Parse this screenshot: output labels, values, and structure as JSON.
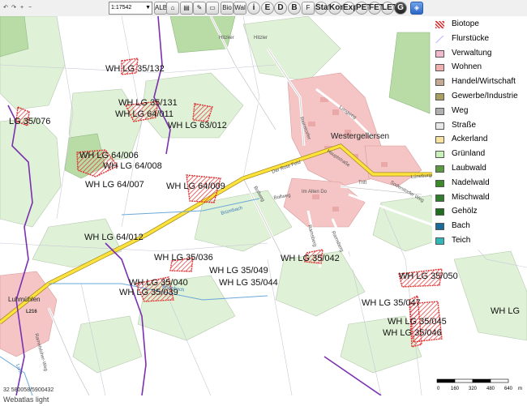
{
  "app": {
    "title": "Webatlas light",
    "coordinates": "32 580058/5900432"
  },
  "toolbar": {
    "scale": "1:17542",
    "buttons": [
      {
        "name": "undo-button",
        "label": "↶",
        "icon": "undo-icon"
      },
      {
        "name": "redo-button",
        "label": "↷",
        "icon": "redo-icon"
      },
      {
        "name": "zoom-in-button",
        "label": "+",
        "icon": "zoom-in-icon"
      },
      {
        "name": "zoom-out-button",
        "label": "−",
        "icon": "zoom-out-icon"
      },
      {
        "name": "alb-button",
        "label": "ALB",
        "icon": "alb-icon"
      },
      {
        "name": "home-button",
        "label": "⌂",
        "icon": "home-icon"
      },
      {
        "name": "print-button",
        "label": "▤",
        "icon": "print-icon"
      },
      {
        "name": "eraser-button",
        "label": "✎",
        "icon": "eraser-icon"
      },
      {
        "name": "measure-area-button",
        "label": "▭",
        "icon": "measure-icon"
      },
      {
        "name": "bio-button",
        "label": "Bio",
        "icon": "bio-icon"
      },
      {
        "name": "wald-button",
        "label": "Wal",
        "icon": "wald-icon"
      },
      {
        "name": "info-button",
        "label": "i",
        "icon": "info-icon"
      },
      {
        "name": "e-button",
        "label": "E",
        "icon": "e-icon"
      },
      {
        "name": "d-button",
        "label": "D",
        "icon": "d-icon"
      },
      {
        "name": "b-button",
        "label": "B",
        "icon": "b-icon"
      },
      {
        "name": "f-button",
        "label": "F",
        "icon": "f-icon"
      },
      {
        "name": "stat-button",
        "label": "Stat",
        "icon": "stat-icon"
      },
      {
        "name": "kons-button",
        "label": "Kons",
        "icon": "kons-icon"
      },
      {
        "name": "exp-button",
        "label": "Exp",
        "icon": "export-icon"
      },
      {
        "name": "pet-button",
        "label": "PET",
        "icon": "pet-icon"
      },
      {
        "name": "fet-button",
        "label": "FET",
        "icon": "fet-icon"
      },
      {
        "name": "let-button",
        "label": "LET",
        "icon": "let-icon"
      },
      {
        "name": "g-button",
        "label": "G",
        "icon": "g-icon"
      },
      {
        "name": "map-view-button",
        "label": "◈",
        "icon": "map-view-icon"
      }
    ]
  },
  "legend": [
    {
      "label": "Biotope",
      "color": "#e03030",
      "style": "hatch"
    },
    {
      "label": "Flurstücke",
      "color": "#c8c8ff",
      "style": "line"
    },
    {
      "label": "Verwaltung",
      "color": "#f2b8cc"
    },
    {
      "label": "Wohnen",
      "color": "#f0b0b0"
    },
    {
      "label": "Handel/Wirtschaft",
      "color": "#c4a890"
    },
    {
      "label": "Gewerbe/Industrie",
      "color": "#a8a060"
    },
    {
      "label": "Weg",
      "color": "#b0b0b0"
    },
    {
      "label": "Straße",
      "color": "#e8e8e8"
    },
    {
      "label": "Ackerland",
      "color": "#f8e3a0"
    },
    {
      "label": "Grünland",
      "color": "#c8f0b8"
    },
    {
      "label": "Laubwald",
      "color": "#5a9a40"
    },
    {
      "label": "Nadelwald",
      "color": "#3a8a2a"
    },
    {
      "label": "Mischwald",
      "color": "#2e7e2e"
    },
    {
      "label": "Gehölz",
      "color": "#1e6e1e"
    },
    {
      "label": "Bach",
      "color": "#1a6a9a"
    },
    {
      "label": "Teich",
      "color": "#30b8b8"
    }
  ],
  "scalebar": {
    "ticks": [
      "0",
      "160",
      "320",
      "480",
      "640"
    ],
    "unit": "m"
  },
  "map": {
    "biotope_labels": [
      "WH LG 35/132",
      "WH LG 35/131",
      "WH LG 64/011",
      "WH LG 63/012",
      "LG 35/076",
      "WH LG 64/006",
      "WH LG 64/008",
      "WH LG 64/007",
      "WH LG 64/009",
      "WH LG 64/012",
      "WH LG 35/036",
      "WH LG 35/049",
      "WH LG 35/044",
      "WH LG 35/042",
      "WH LG 35/040",
      "WH LG 35/039",
      "WH LG 35/050",
      "WH LG 35/047",
      "WH LG 35/045",
      "WH LG 35/046",
      "WH LG"
    ],
    "place_labels": [
      "Westergellersen",
      "Luhmühlen"
    ],
    "street_labels": [
      "Hitzker",
      "Hitzler",
      "Longweg",
      "Reinstorfer",
      "Der Rote Feld",
      "Hauptstraße",
      "Lüneburger",
      "Soderstorfer Weg",
      "Bollweg",
      "Im Alten Do",
      "Trift",
      "Bollweg",
      "Ramsberg",
      "Ramsberg",
      "Brümbach",
      "Brümbach",
      "Luhe",
      "L216",
      "Ramelsloher-Weg"
    ]
  }
}
